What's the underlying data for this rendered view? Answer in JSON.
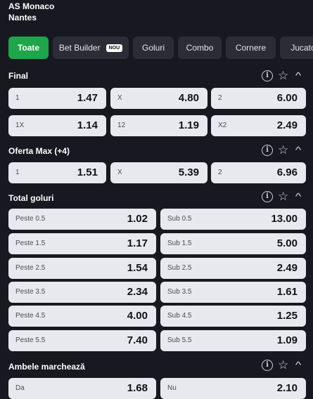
{
  "match": {
    "home": "AS Monaco",
    "away": "Nantes"
  },
  "tabs": [
    {
      "label": "Toate",
      "active": true
    },
    {
      "label": "Bet Builder",
      "badge": "NOU"
    },
    {
      "label": "Goluri"
    },
    {
      "label": "Combo"
    },
    {
      "label": "Cornere"
    },
    {
      "label": "Jucato"
    }
  ],
  "colors": {
    "accent": "#1fa54a",
    "background": "#181920",
    "odd_bg": "#e8e9ee"
  },
  "icons": [
    "info-icon",
    "star-icon",
    "chevron-up-icon"
  ],
  "sections": [
    {
      "title": "Final",
      "rows": [
        [
          {
            "label": "1",
            "value": "1.47"
          },
          {
            "label": "X",
            "value": "4.80"
          },
          {
            "label": "2",
            "value": "6.00"
          }
        ],
        [
          {
            "label": "1X",
            "value": "1.14"
          },
          {
            "label": "12",
            "value": "1.19"
          },
          {
            "label": "X2",
            "value": "2.49"
          }
        ]
      ]
    },
    {
      "title": "Oferta Max (+4)",
      "rows": [
        [
          {
            "label": "1",
            "value": "1.51"
          },
          {
            "label": "X",
            "value": "5.39"
          },
          {
            "label": "2",
            "value": "6.96"
          }
        ]
      ]
    },
    {
      "title": "Total goluri",
      "rows": [
        [
          {
            "label": "Peste 0.5",
            "value": "1.02"
          },
          {
            "label": "Sub 0.5",
            "value": "13.00"
          }
        ],
        [
          {
            "label": "Peste 1.5",
            "value": "1.17"
          },
          {
            "label": "Sub 1.5",
            "value": "5.00"
          }
        ],
        [
          {
            "label": "Peste 2.5",
            "value": "1.54"
          },
          {
            "label": "Sub 2.5",
            "value": "2.49"
          }
        ],
        [
          {
            "label": "Peste 3.5",
            "value": "2.34"
          },
          {
            "label": "Sub 3.5",
            "value": "1.61"
          }
        ],
        [
          {
            "label": "Peste 4.5",
            "value": "4.00"
          },
          {
            "label": "Sub 4.5",
            "value": "1.25"
          }
        ],
        [
          {
            "label": "Peste 5.5",
            "value": "7.40"
          },
          {
            "label": "Sub 5.5",
            "value": "1.09"
          }
        ]
      ]
    },
    {
      "title": "Ambele marchează",
      "rows": [
        [
          {
            "label": "Da",
            "value": "1.68"
          },
          {
            "label": "Nu",
            "value": "2.10"
          }
        ]
      ]
    }
  ]
}
